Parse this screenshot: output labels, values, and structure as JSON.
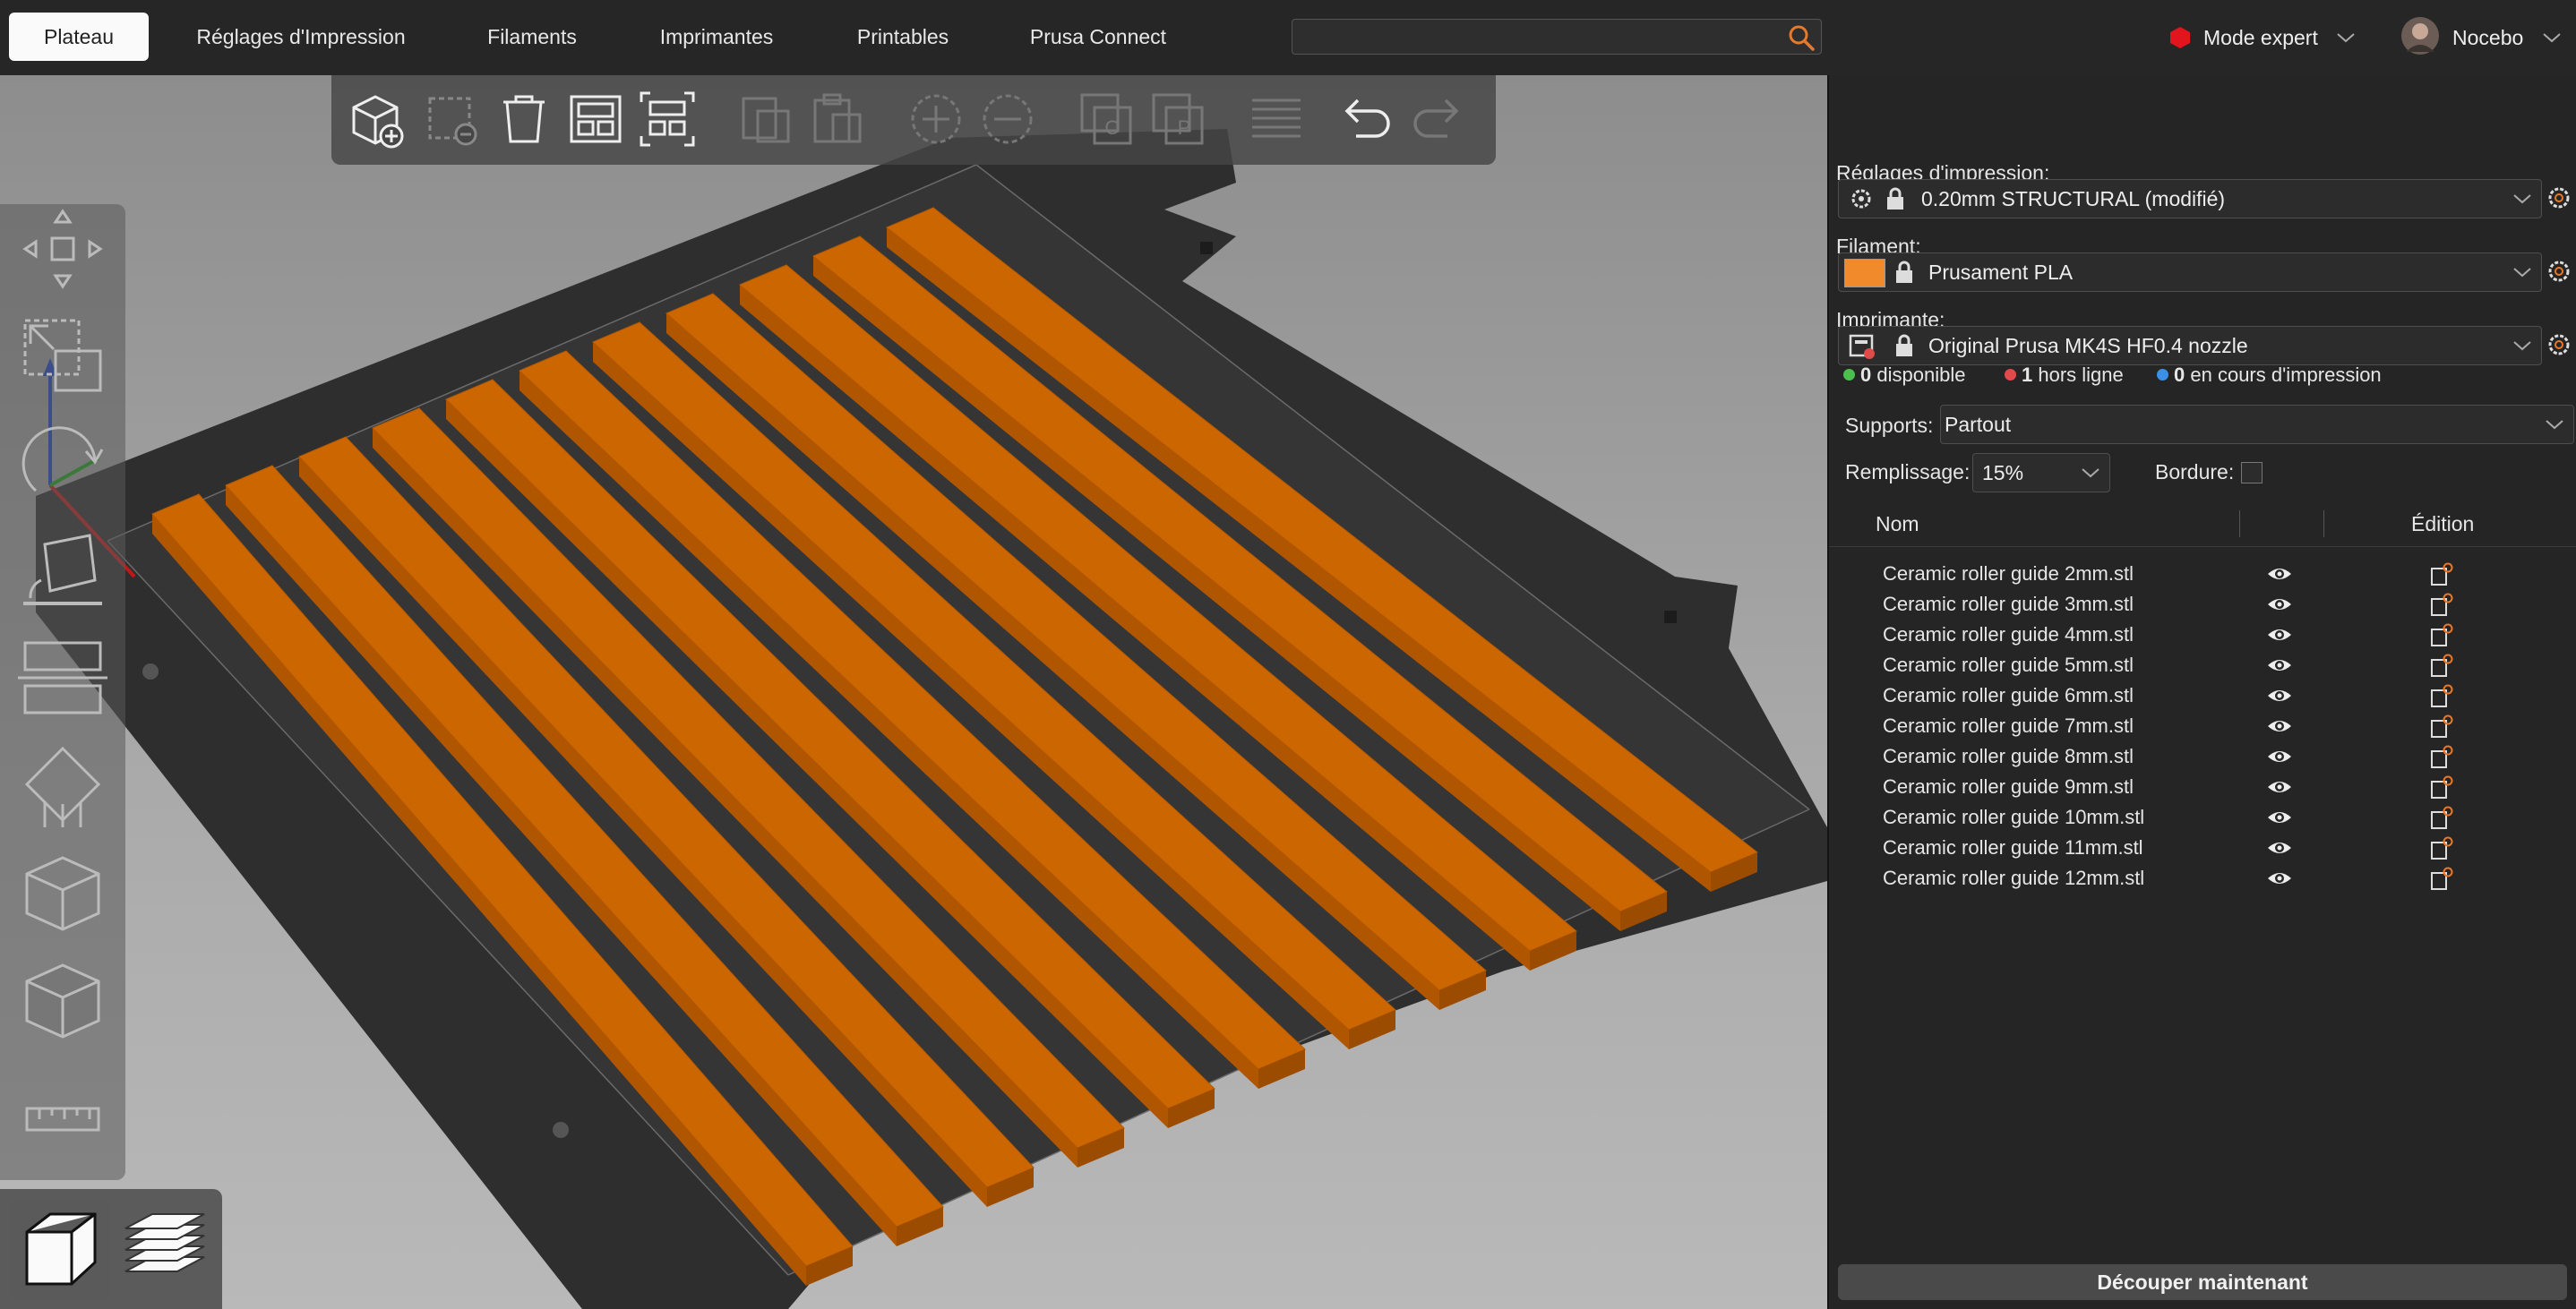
{
  "tabs": [
    {
      "label": "Plateau",
      "active": true
    },
    {
      "label": "Réglages d'Impression",
      "active": false
    },
    {
      "label": "Filaments",
      "active": false
    },
    {
      "label": "Imprimantes",
      "active": false
    },
    {
      "label": "Printables",
      "active": false
    },
    {
      "label": "Prusa Connect",
      "active": false
    }
  ],
  "search": {
    "value": "",
    "placeholder": "",
    "icon": "search-icon"
  },
  "mode": {
    "label": "Mode expert",
    "color": "#e2141e"
  },
  "user": {
    "name": "Nocebo"
  },
  "toolbar_top": [
    "add-icon",
    "delete-icon",
    "delete-all-icon",
    "arrange-icon",
    "arrange-selection-icon",
    "copy-icon",
    "paste-icon",
    "add-instance-icon",
    "remove-instance-icon",
    "split-objects-icon",
    "split-parts-icon",
    "layers-editing-icon",
    "undo-icon",
    "redo-icon"
  ],
  "toolbar_left": [
    "move-icon",
    "scale-icon",
    "rotate-icon",
    "place-on-face-icon",
    "cut-icon",
    "paint-supports-icon",
    "seam-painting-icon",
    "mmu-painting-icon",
    "measure-icon"
  ],
  "view_switch": [
    "3d-view-icon",
    "preview-layers-icon"
  ],
  "sidebar": {
    "print_settings_label": "Réglages d'impression:",
    "print_settings_value": "0.20mm STRUCTURAL (modifié)",
    "filament_label": "Filament:",
    "filament_value": "Prusament PLA",
    "filament_color": "#f08a2a",
    "printer_label": "Imprimante:",
    "printer_value": "Original Prusa MK4S HF0.4 nozzle",
    "status": [
      {
        "count": "0",
        "text": "disponible",
        "color": "#4cc04c"
      },
      {
        "count": "1",
        "text": "hors ligne",
        "color": "#e24a4a"
      },
      {
        "count": "0",
        "text": "en cours d'impression",
        "color": "#3b8fe6"
      }
    ],
    "supports_label": "Supports:",
    "supports_value": "Partout",
    "infill_label": "Remplissage:",
    "infill_value": "15%",
    "brim_label": "Bordure:",
    "brim_checked": false,
    "col_name": "Nom",
    "col_edit": "Édition",
    "objects": [
      "Ceramic roller guide 2mm.stl",
      "Ceramic roller guide 3mm.stl",
      "Ceramic roller guide 4mm.stl",
      "Ceramic roller guide 5mm.stl",
      "Ceramic roller guide 6mm.stl",
      "Ceramic roller guide 7mm.stl",
      "Ceramic roller guide 8mm.stl",
      "Ceramic roller guide 9mm.stl",
      "Ceramic roller guide 10mm.stl",
      "Ceramic roller guide 11mm.stl",
      "Ceramic roller guide 12mm.stl"
    ],
    "slice_button": "Découper maintenant"
  },
  "colors": {
    "accent": "#e8782a",
    "part": "#cc6600"
  }
}
